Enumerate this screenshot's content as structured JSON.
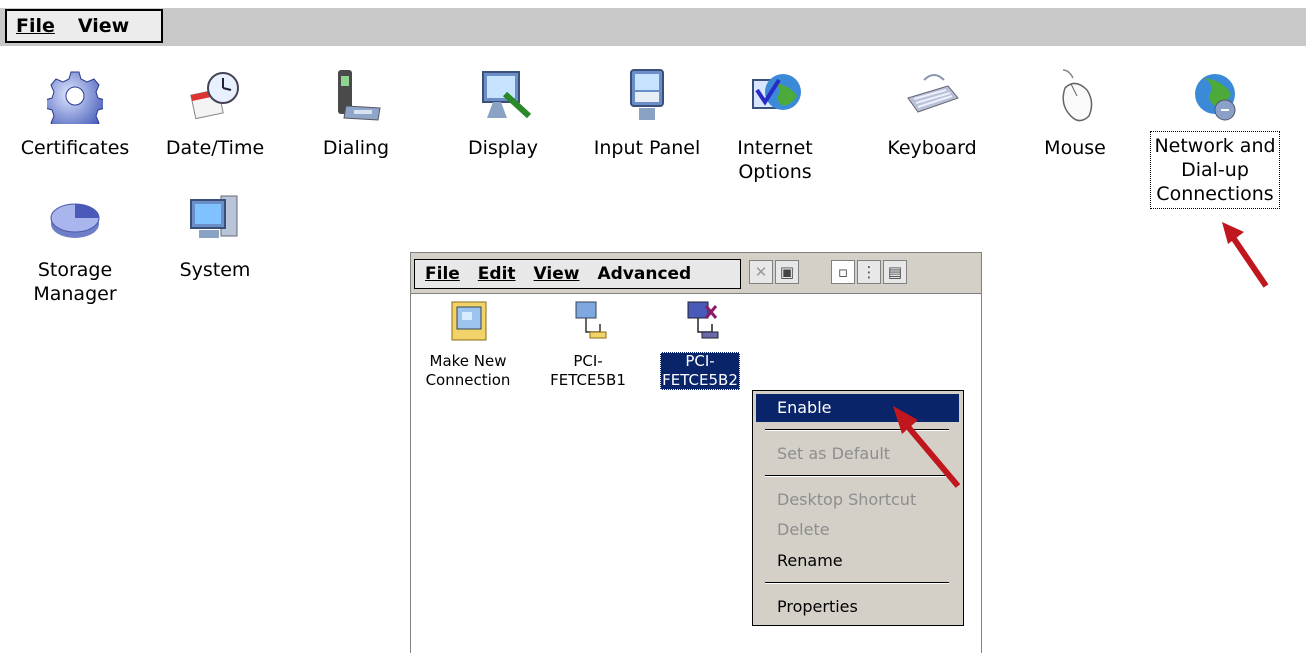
{
  "menubar": {
    "file": "File",
    "view": "View"
  },
  "control_panel": {
    "items": [
      {
        "label": "Certificates",
        "icon": "gear-icon"
      },
      {
        "label": "Date/Time",
        "icon": "clock-calendar-icon"
      },
      {
        "label": "Dialing",
        "icon": "phone-modem-icon"
      },
      {
        "label": "Display",
        "icon": "monitor-brush-icon"
      },
      {
        "label": "Input Panel",
        "icon": "keyboard-monitor-icon"
      },
      {
        "label": "Internet Options",
        "lines": [
          "Internet",
          "Options"
        ],
        "icon": "globe-check-icon"
      },
      {
        "label": "Keyboard",
        "icon": "keyboard-icon"
      },
      {
        "label": "Mouse",
        "icon": "mouse-icon"
      },
      {
        "label": "Network and Dial-up Connections",
        "lines": [
          "Network and",
          "Dial-up",
          "Connections"
        ],
        "icon": "network-globe-icon"
      },
      {
        "label": "Storage Manager",
        "lines": [
          "Storage",
          "Manager"
        ],
        "icon": "disk-pie-icon"
      },
      {
        "label": "System",
        "icon": "computer-icon"
      }
    ]
  },
  "connections_window": {
    "menu": {
      "file": "File",
      "edit": "Edit",
      "view": "View",
      "advanced": "Advanced"
    },
    "toolbar": [
      "delete-icon",
      "properties-icon",
      "large-icons-icon",
      "list-icon",
      "details-icon"
    ],
    "items": [
      {
        "lines": [
          "Make New",
          "Connection"
        ],
        "selected": false
      },
      {
        "lines": [
          "PCI-",
          "FETCE5B1"
        ],
        "selected": false
      },
      {
        "lines": [
          "PCI-",
          "FETCE5B2"
        ],
        "selected": true,
        "disabled": true
      }
    ]
  },
  "context_menu": {
    "enable": "Enable",
    "set_default": "Set as Default",
    "desktop_shortcut": "Desktop Shortcut",
    "delete": "Delete",
    "rename": "Rename",
    "properties": "Properties"
  },
  "colors": {
    "selection": "#0a246a",
    "arrow": "#c0161d",
    "menubar": "#c8c8c8"
  }
}
